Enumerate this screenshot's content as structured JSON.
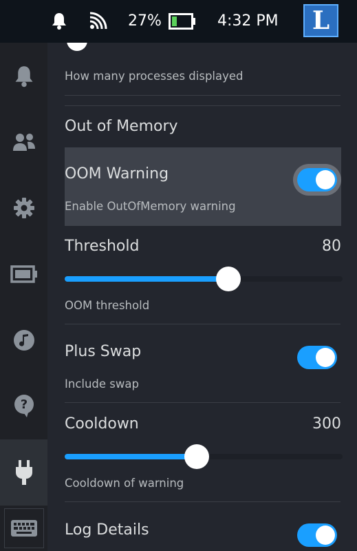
{
  "status": {
    "battery_percent": "27%",
    "battery_level": 0.27,
    "time": "4:32 PM",
    "avatar_letter": "L"
  },
  "sidebar": {
    "items": [
      {
        "icon": "bell-icon"
      },
      {
        "icon": "friends-icon"
      },
      {
        "icon": "gear-icon"
      },
      {
        "icon": "battery-icon"
      },
      {
        "icon": "music-icon"
      },
      {
        "icon": "help-icon"
      },
      {
        "icon": "plug-icon",
        "active": true
      },
      {
        "icon": "keyboard-icon"
      }
    ]
  },
  "settings": {
    "processes_desc": "How many processes displayed",
    "section_title": "Out of Memory",
    "oom_warning": {
      "label": "OOM Warning",
      "desc": "Enable OutOfMemory warning",
      "enabled": true
    },
    "threshold": {
      "label": "Threshold",
      "value": "80",
      "desc": "OOM threshold",
      "fraction": 0.59
    },
    "plus_swap": {
      "label": "Plus Swap",
      "desc": "Include swap",
      "enabled": true
    },
    "cooldown": {
      "label": "Cooldown",
      "value": "300",
      "desc": "Cooldown of warning",
      "fraction": 0.475
    },
    "log_details": {
      "label": "Log Details",
      "enabled": true
    }
  },
  "colors": {
    "accent": "#1a9fff",
    "background": "#23262e",
    "sidebar": "#1f2126",
    "highlight": "#3e424b"
  }
}
